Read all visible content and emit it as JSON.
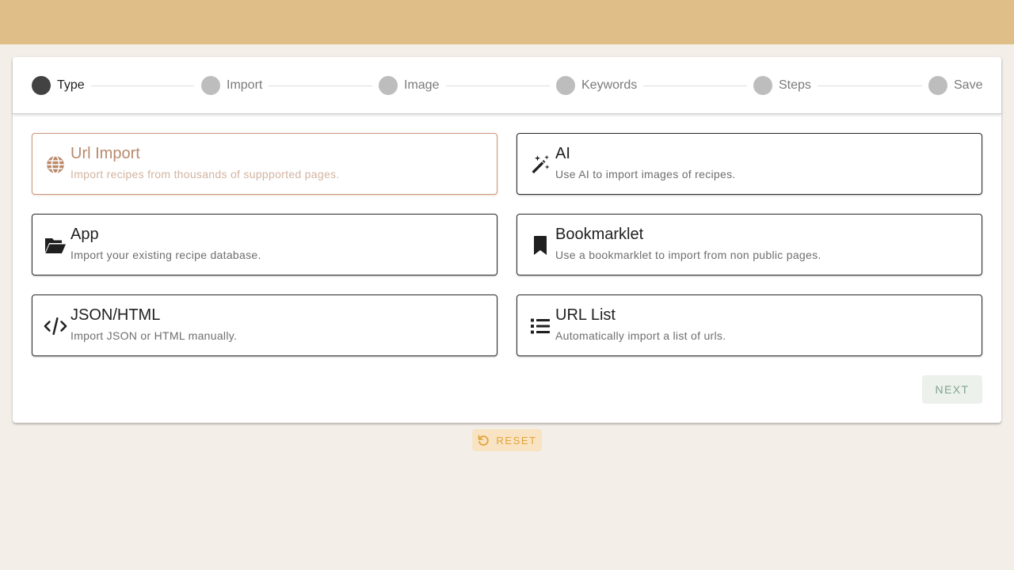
{
  "stepper": {
    "steps": [
      {
        "label": "Type",
        "active": true
      },
      {
        "label": "Import",
        "active": false
      },
      {
        "label": "Image",
        "active": false
      },
      {
        "label": "Keywords",
        "active": false
      },
      {
        "label": "Steps",
        "active": false
      },
      {
        "label": "Save",
        "active": false
      }
    ]
  },
  "options": [
    {
      "title": "Url Import",
      "description": "Import recipes from thousands of suppported pages.",
      "icon": "globe-icon",
      "selected": true
    },
    {
      "title": "AI",
      "description": "Use AI to import images of recipes.",
      "icon": "magic-wand-icon",
      "selected": false
    },
    {
      "title": "App",
      "description": "Import your existing recipe database.",
      "icon": "folder-open-icon",
      "selected": false
    },
    {
      "title": "Bookmarklet",
      "description": "Use a bookmarklet to import from non public pages.",
      "icon": "bookmark-icon",
      "selected": false
    },
    {
      "title": "JSON/HTML",
      "description": "Import JSON or HTML manually.",
      "icon": "code-icon",
      "selected": false
    },
    {
      "title": "URL List",
      "description": "Automatically import a list of urls.",
      "icon": "list-icon",
      "selected": false
    }
  ],
  "actions": {
    "next_label": "NEXT",
    "reset_label": "RESET"
  },
  "colors": {
    "topbar": "#dfbf87",
    "background": "#f3eee8",
    "selected_accent": "#b98a6c",
    "next_text": "#7fa38a",
    "reset_text": "#e3a33c"
  }
}
